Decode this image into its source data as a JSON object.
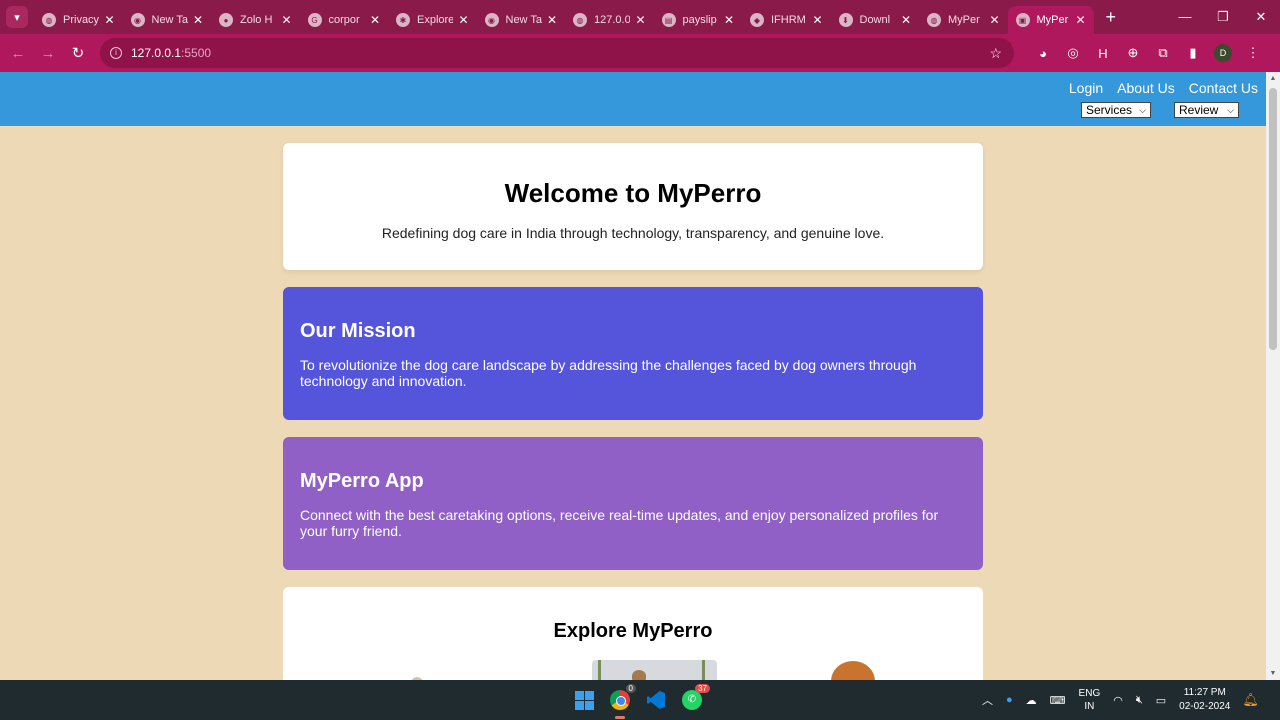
{
  "browser": {
    "tabs": [
      {
        "title": "Privacy",
        "icon": "globe-icon"
      },
      {
        "title": "New Tab",
        "icon": "chrome-icon"
      },
      {
        "title": "Zolo H",
        "icon": "zolo-icon"
      },
      {
        "title": "corpor",
        "icon": "google-icon"
      },
      {
        "title": "Explore",
        "icon": "pinwheel-icon"
      },
      {
        "title": "New Tab",
        "icon": "chrome-icon"
      },
      {
        "title": "127.0.0",
        "icon": "globe-icon"
      },
      {
        "title": "payslip",
        "icon": "document-icon"
      },
      {
        "title": "IFHRM",
        "icon": "logo-icon"
      },
      {
        "title": "Downl",
        "icon": "download-icon"
      },
      {
        "title": "MyPer",
        "icon": "globe-icon"
      },
      {
        "title": "MyPer",
        "icon": "page-icon",
        "active": true
      }
    ],
    "url_host": "127.0.0.1",
    "url_port": ":5500"
  },
  "header": {
    "links": [
      "Login",
      "About Us",
      "Contact Us"
    ],
    "services_select": "Services",
    "review_select": "Review"
  },
  "welcome": {
    "title": "Welcome to MyPerro",
    "subtitle": "Redefining dog care in India through technology, transparency, and genuine love."
  },
  "mission": {
    "title": "Our Mission",
    "text": "To revolutionize the dog care landscape by addressing the challenges faced by dog owners through technology and innovation."
  },
  "app": {
    "title": "MyPerro App",
    "text": "Connect with the best caretaking options, receive real-time updates, and enjoy personalized profiles for your furry friend."
  },
  "explore": {
    "title": "Explore MyPerro"
  },
  "taskbar": {
    "chrome_badge": "0",
    "whatsapp_badge": "37",
    "lang_line1": "ENG",
    "lang_line2": "IN",
    "time": "11:27 PM",
    "date": "02-02-2024"
  },
  "colors": {
    "page_bg": "#eed9b6",
    "header_bg": "#3498db",
    "mission_bg": "#5555db",
    "app_bg": "#9160c6",
    "chrome_frame": "#b0185d"
  }
}
